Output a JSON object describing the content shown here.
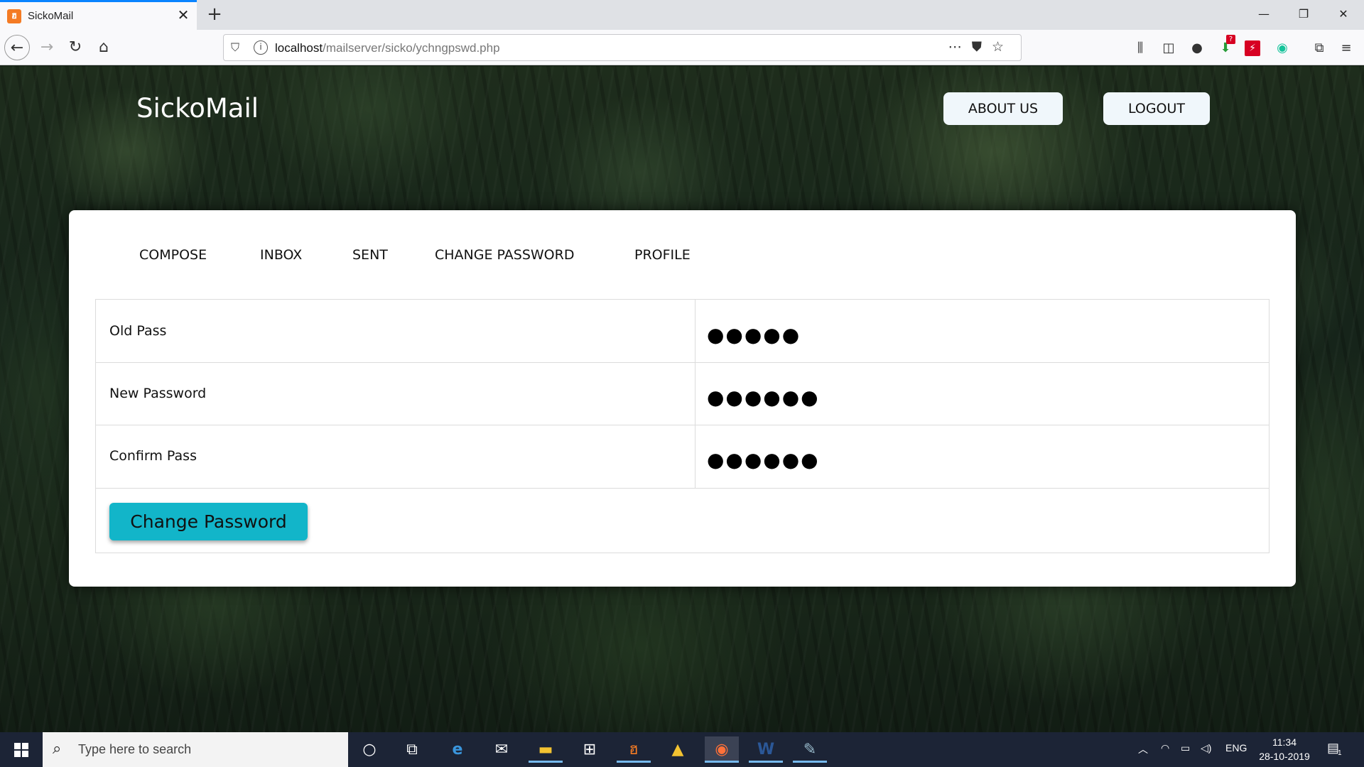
{
  "browser": {
    "tab_title": "SickoMail",
    "tab_close_glyph": "✕",
    "new_tab_glyph": "+",
    "url_host": "localhost",
    "url_path": "/mailserver/sicko/ychngpswd.php",
    "window_controls": {
      "minimize": "—",
      "restore": "❐",
      "close": "✕"
    },
    "extension_badge": "?"
  },
  "header": {
    "brand": "SickoMail",
    "about_label": "ABOUT US",
    "logout_label": "LOGOUT"
  },
  "menu": {
    "compose": "COMPOSE",
    "inbox": "INBOX",
    "sent": "SENT",
    "change_password": "CHANGE PASSWORD",
    "profile": "PROFILE"
  },
  "form": {
    "old_label": "Old Pass",
    "old_value": "●●●●●",
    "new_label": "New Password",
    "new_value": "●●●●●●",
    "confirm_label": "Confirm Pass",
    "confirm_value": "●●●●●●",
    "submit_label": "Change Password"
  },
  "taskbar": {
    "search_placeholder": "Type here to search",
    "language": "ENG",
    "time": "11:34",
    "date": "28-10-2019",
    "notification_count": "1"
  },
  "colors": {
    "accent_button": "#12b5c9",
    "tab_highlight": "#0a84ff",
    "taskbar_bg": "#1c2436"
  }
}
